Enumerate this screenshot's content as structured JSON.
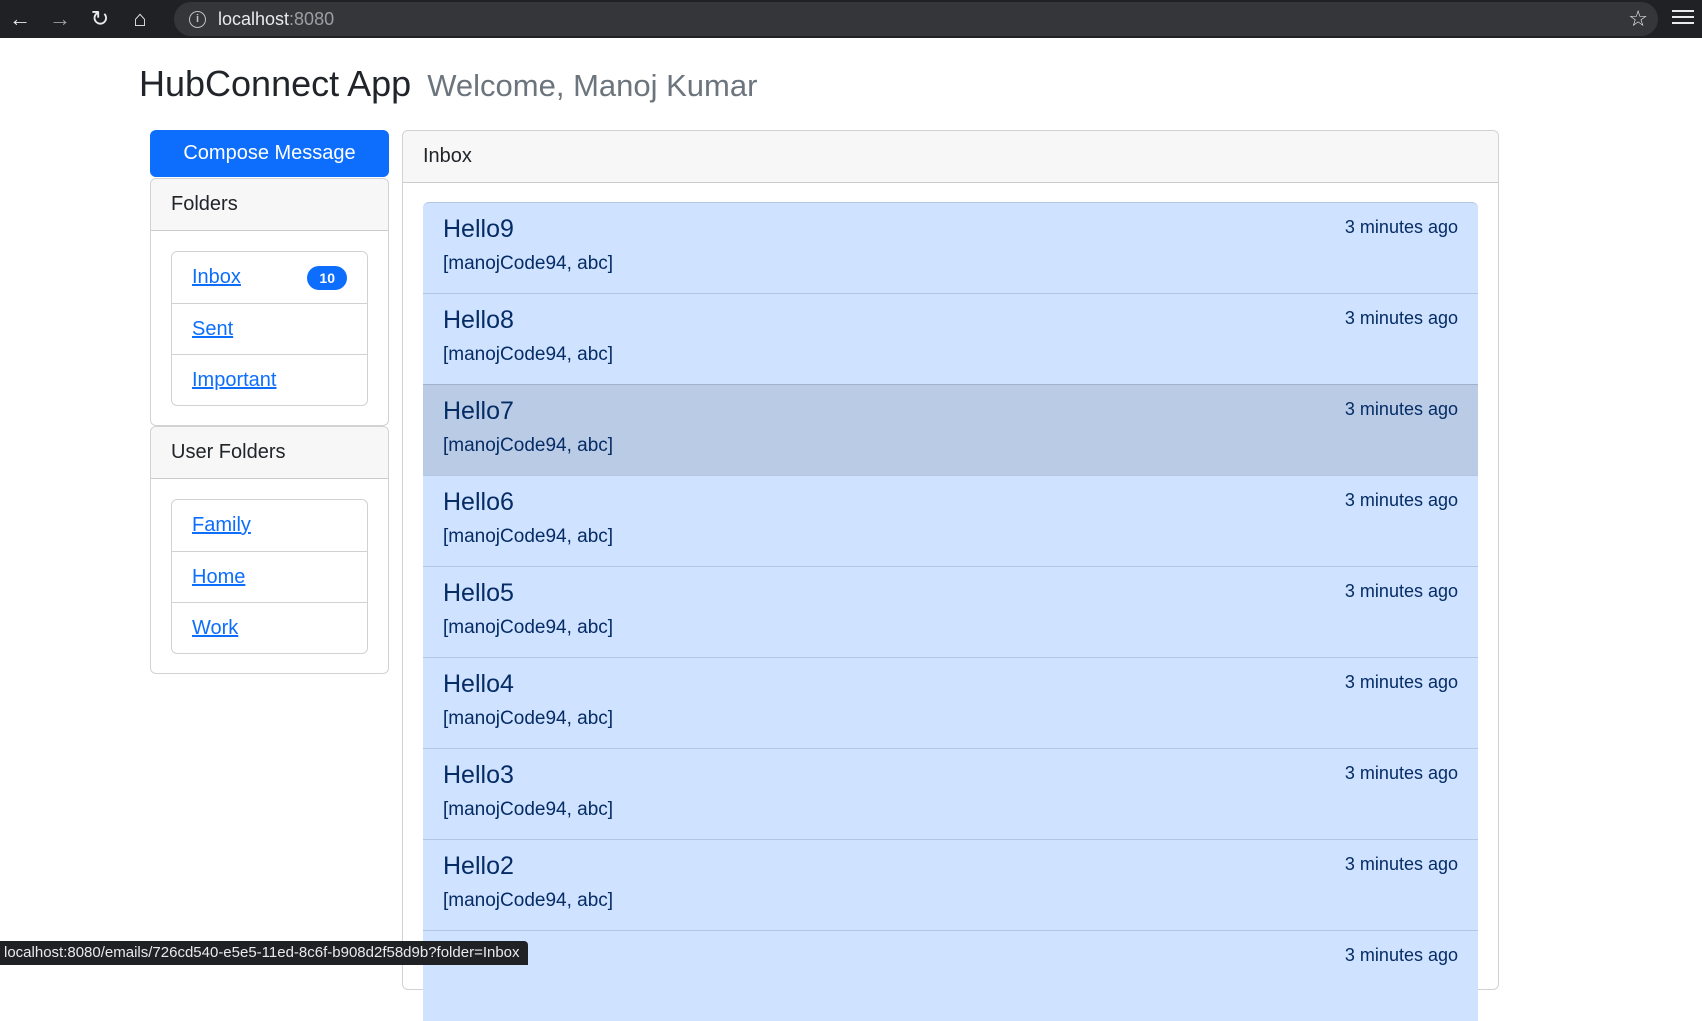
{
  "browser": {
    "url_host": "localhost",
    "url_port": ":8080",
    "status_url": "localhost:8080/emails/726cd540-e5e5-11ed-8c6f-b908d2f58d9b?folder=Inbox"
  },
  "header": {
    "title": "HubConnect App",
    "welcome": "Welcome, Manoj Kumar"
  },
  "compose_label": "Compose Message",
  "folders": {
    "title": "Folders",
    "items": [
      {
        "label": "Inbox",
        "count": "10"
      },
      {
        "label": "Sent"
      },
      {
        "label": "Important"
      }
    ]
  },
  "user_folders": {
    "title": "User Folders",
    "items": [
      {
        "label": "Family"
      },
      {
        "label": "Home"
      },
      {
        "label": "Work"
      }
    ]
  },
  "inbox": {
    "title": "Inbox",
    "messages": [
      {
        "subject": "Hello9",
        "recipients": "[manojCode94, abc]",
        "time": "3 minutes ago"
      },
      {
        "subject": "Hello8",
        "recipients": "[manojCode94, abc]",
        "time": "3 minutes ago"
      },
      {
        "subject": "Hello7",
        "recipients": "[manojCode94, abc]",
        "time": "3 minutes ago",
        "hovered": true
      },
      {
        "subject": "Hello6",
        "recipients": "[manojCode94, abc]",
        "time": "3 minutes ago"
      },
      {
        "subject": "Hello5",
        "recipients": "[manojCode94, abc]",
        "time": "3 minutes ago"
      },
      {
        "subject": "Hello4",
        "recipients": "[manojCode94, abc]",
        "time": "3 minutes ago"
      },
      {
        "subject": "Hello3",
        "recipients": "[manojCode94, abc]",
        "time": "3 minutes ago"
      },
      {
        "subject": "Hello2",
        "recipients": "[manojCode94, abc]",
        "time": "3 minutes ago"
      },
      {
        "subject": "",
        "recipients": "",
        "time": "3 minutes ago"
      }
    ]
  },
  "colors": {
    "primary": "#0d6efd",
    "message_bg": "#cfe2ff",
    "message_hover_bg": "#bacbe6",
    "browser_chrome": "#202124"
  }
}
